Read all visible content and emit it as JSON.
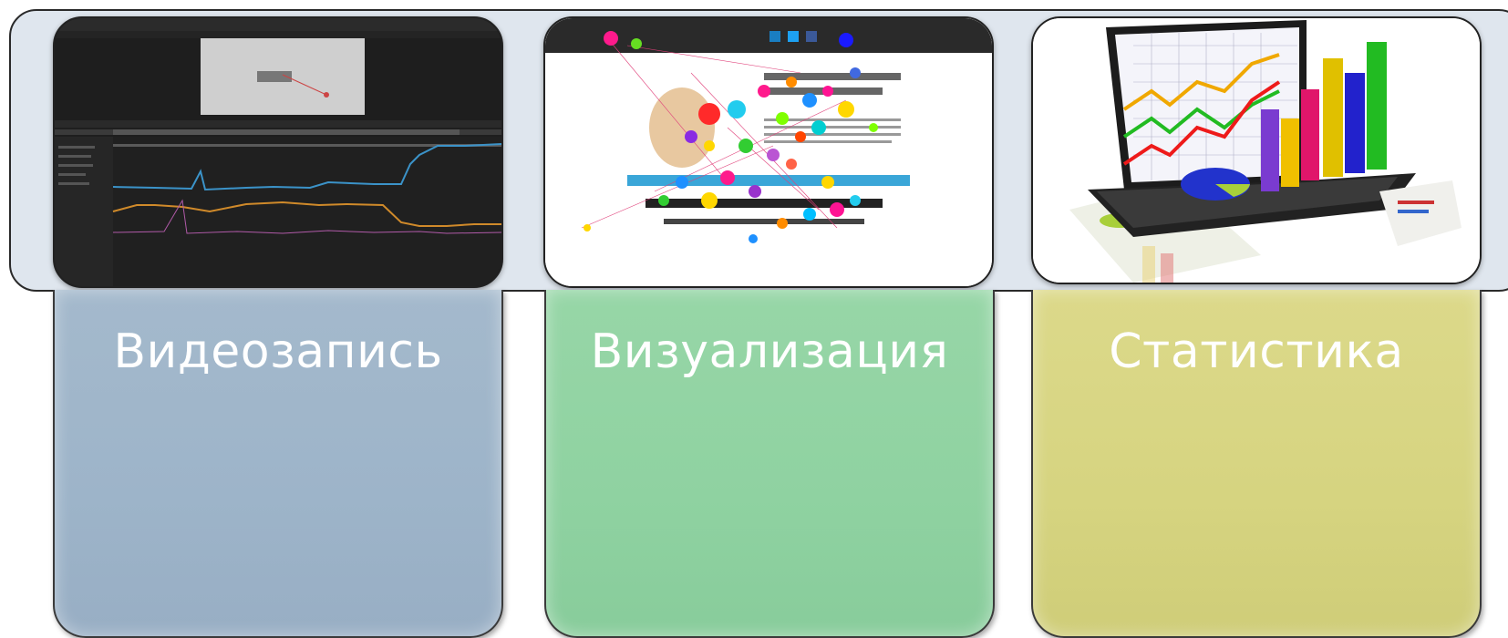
{
  "cards": [
    {
      "label": "Видеозапись",
      "color": "#9db4c9",
      "thumbnail": "video-recording-software-screenshot"
    },
    {
      "label": "Визуализация",
      "color": "#8fd2a1",
      "thumbnail": "eye-tracking-gaze-plot-screenshot"
    },
    {
      "label": "Статистика",
      "color": "#d6d480",
      "thumbnail": "laptop-with-3d-charts-image"
    }
  ]
}
